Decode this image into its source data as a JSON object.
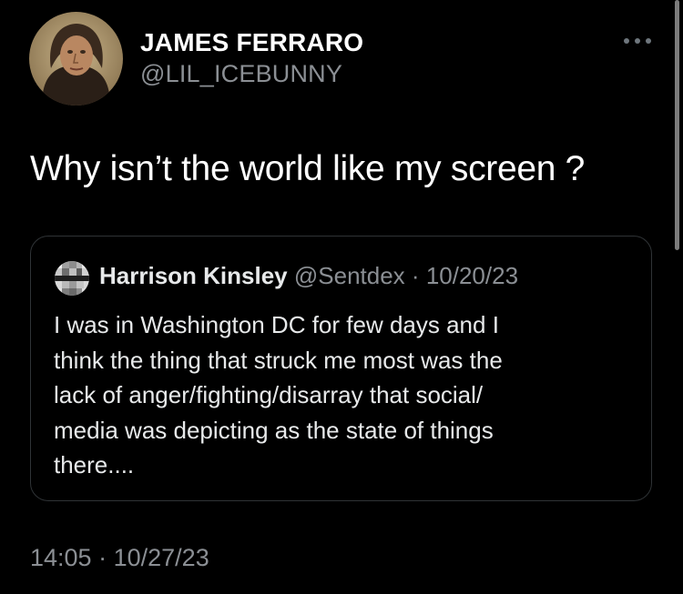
{
  "author": {
    "name": "JAMES FERRARO",
    "handle": "@LIL_ICEBUNNY",
    "avatar_icon": "portrait-avatar-icon"
  },
  "more_icon": "more-dots-icon",
  "tweet": {
    "text": "Why isn’t the world like my screen ?",
    "time": "14:05",
    "separator": "·",
    "date": "10/27/23"
  },
  "quote": {
    "name": "Harrison Kinsley",
    "handle": "@Sentdex",
    "separator": "·",
    "date": "10/20/23",
    "avatar_icon": "pixelated-avatar-icon",
    "lines": [
      "I was in Washington DC for few days and I",
      "think the thing that struck me most was the",
      "lack of anger/fighting/disarray that social/",
      "media was depicting as the state of things",
      "there...."
    ]
  },
  "colors": {
    "background": "#000000",
    "primary_text": "#ffffff",
    "secondary_text": "#8b8f94",
    "border": "#2f3336"
  }
}
